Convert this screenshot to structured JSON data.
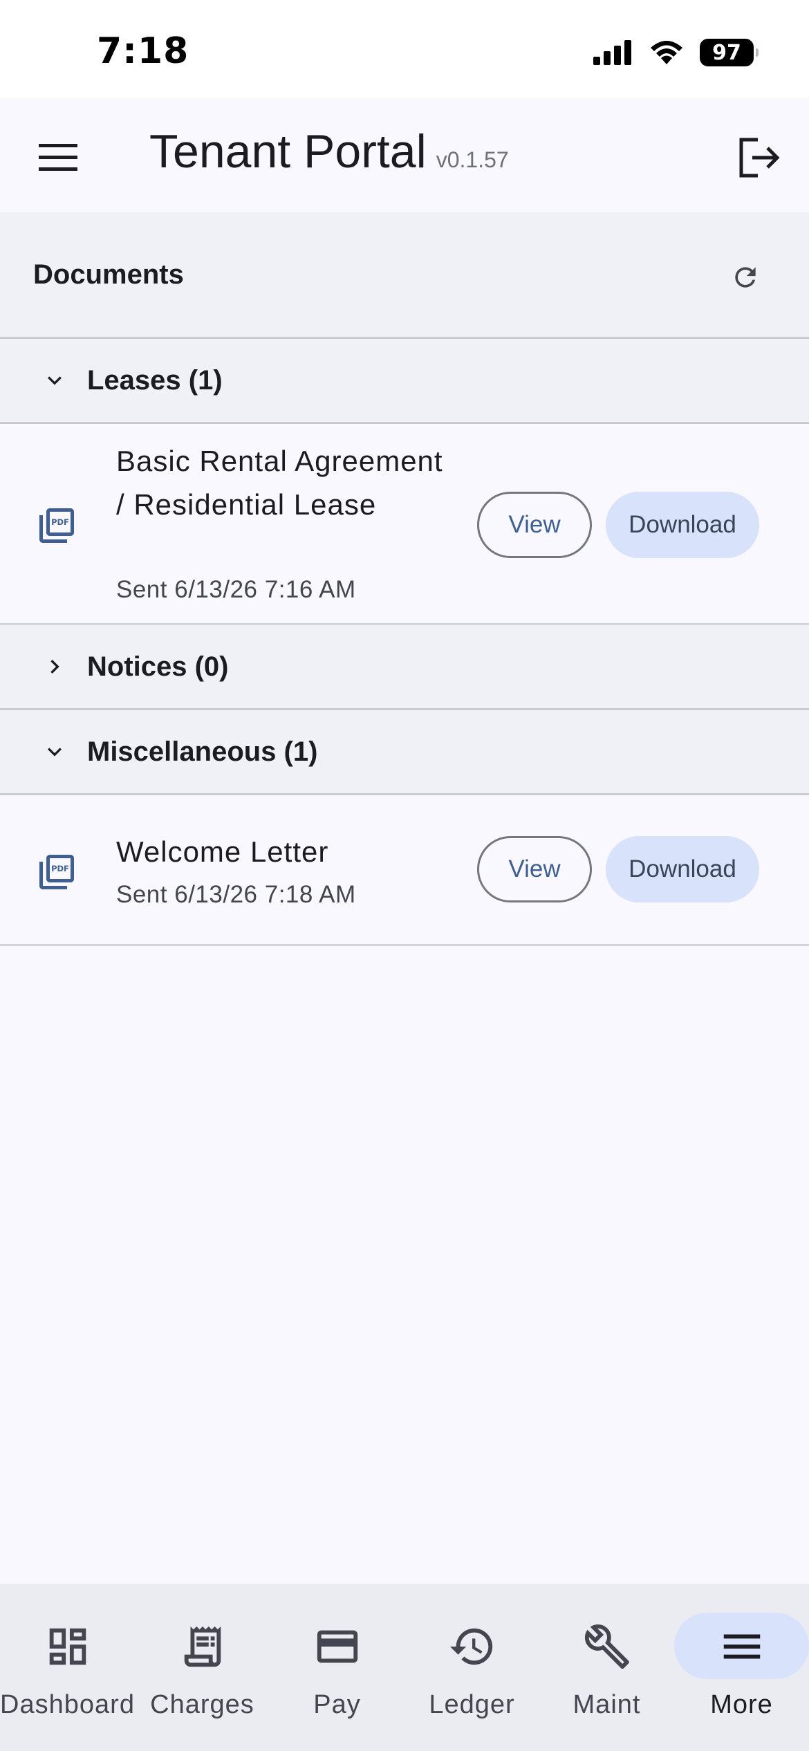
{
  "status_bar": {
    "time": "7:18",
    "battery": "97"
  },
  "app_bar": {
    "title": "Tenant Portal",
    "version": "v0.1.57"
  },
  "section": {
    "title": "Documents"
  },
  "groups": [
    {
      "label": "Leases (1)",
      "expanded": true
    },
    {
      "label": "Notices (0)",
      "expanded": false
    },
    {
      "label": "Miscellaneous (1)",
      "expanded": true
    }
  ],
  "documents": [
    {
      "title": "Basic Rental Agreement / Residential Lease",
      "sent": "Sent 6/13/26 7:16 AM",
      "view_label": "View",
      "download_label": "Download"
    },
    {
      "title": "Welcome Letter",
      "sent": "Sent 6/13/26 7:18 AM",
      "view_label": "View",
      "download_label": "Download"
    }
  ],
  "bottom_nav": [
    {
      "label": "Dashboard",
      "icon": "dashboard-icon",
      "active": false
    },
    {
      "label": "Charges",
      "icon": "receipt-icon",
      "active": false
    },
    {
      "label": "Pay",
      "icon": "credit-card-icon",
      "active": false
    },
    {
      "label": "Ledger",
      "icon": "history-icon",
      "active": false
    },
    {
      "label": "Maint",
      "icon": "wrench-icon",
      "active": false
    },
    {
      "label": "More",
      "icon": "menu-icon",
      "active": true
    }
  ],
  "colors": {
    "accent": "#3e5f90",
    "pill": "#d8e2fb",
    "background": "#f8f8fe",
    "surface": "#f0f1f7"
  }
}
